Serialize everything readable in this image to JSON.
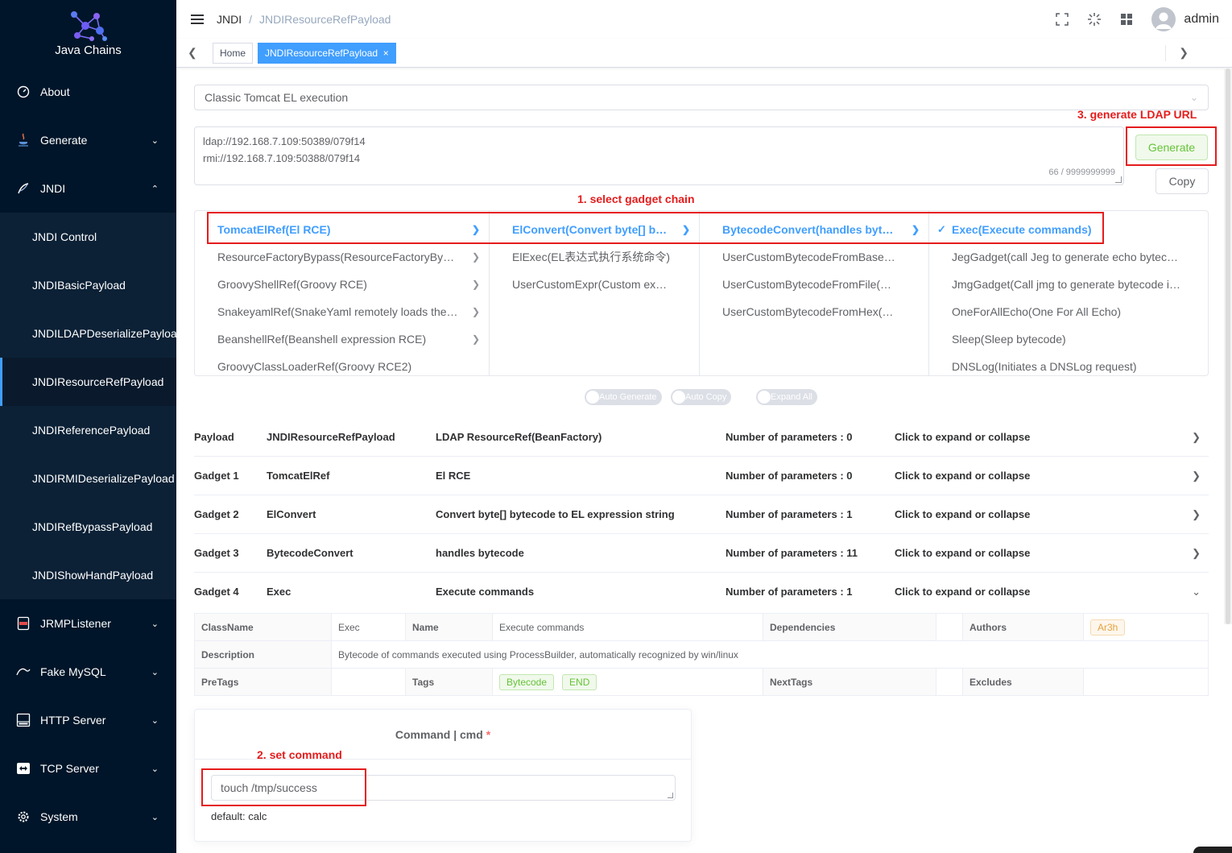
{
  "app": {
    "name": "Java Chains"
  },
  "sidebar": {
    "items": [
      {
        "label": "About",
        "icon": "dashboard-icon"
      },
      {
        "label": "Generate",
        "icon": "java-icon"
      },
      {
        "label": "JNDI",
        "icon": "feather-icon"
      },
      {
        "label": "JNDI Control"
      },
      {
        "label": "JNDIBasicPayload"
      },
      {
        "label": "JNDILDAPDeserializePayload"
      },
      {
        "label": "JNDIResourceRefPayload"
      },
      {
        "label": "JNDIReferencePayload"
      },
      {
        "label": "JNDIRMIDeserializePayload"
      },
      {
        "label": "JNDIRefBypassPayload"
      },
      {
        "label": "JNDIShowHandPayload"
      },
      {
        "label": "JRMPListener",
        "icon": "jrmp-icon"
      },
      {
        "label": "Fake MySQL",
        "icon": "mysql-icon"
      },
      {
        "label": "HTTP Server",
        "icon": "http-icon"
      },
      {
        "label": "TCP Server",
        "icon": "tcp-icon"
      },
      {
        "label": "System",
        "icon": "gear-icon"
      }
    ]
  },
  "header": {
    "breadcrumb": [
      "JNDI",
      "JNDIResourceRefPayload"
    ],
    "user": "admin"
  },
  "tags": {
    "home": "Home",
    "active": "JNDIResourceRefPayload",
    "close": "×"
  },
  "form": {
    "select_value": "Classic Tomcat EL execution",
    "urls": [
      "ldap://192.168.7.109:50389/079f14",
      "rmi://192.168.7.109:50388/079f14"
    ],
    "char_count": "66 / 9999999999",
    "generate_label": "Generate",
    "copy_label": "Copy"
  },
  "annotations": {
    "generate": "3. generate LDAP URL",
    "select": "1. select  gadget chain",
    "command": "2. set command"
  },
  "cascader": {
    "col1": [
      "TomcatElRef(El RCE)",
      "ResourceFactoryBypass(ResourceFactoryBy…",
      "GroovyShellRef(Groovy RCE)",
      "SnakeyamlRef(SnakeYaml remotely loads the…",
      "BeanshellRef(Beanshell expression RCE)",
      "GroovyClassLoaderRef(Groovy RCE2)"
    ],
    "col2": [
      "ElConvert(Convert byte[] b…",
      "ElExec(EL表达式执行系统命令)",
      "UserCustomExpr(Custom ex…"
    ],
    "col3": [
      "BytecodeConvert(handles byt…",
      "UserCustomBytecodeFromBase…",
      "UserCustomBytecodeFromFile(…",
      "UserCustomBytecodeFromHex(…"
    ],
    "col4": [
      "Exec(Execute commands)",
      "JegGadget(call Jeg to generate echo bytec…",
      "JmgGadget(Call jmg to generate bytecode i…",
      "OneForAllEcho(One For All Echo)",
      "Sleep(Sleep bytecode)",
      "DNSLog(Initiates a DNSLog request)"
    ]
  },
  "switches": [
    "Auto Generate",
    "Auto Copy",
    "Expand All"
  ],
  "rows": [
    {
      "c1": "Payload",
      "c2": "JNDIResourceRefPayload",
      "c3": "LDAP ResourceRef(BeanFactory)",
      "c4": "Number of parameters : 0",
      "c5": "Click to expand or collapse"
    },
    {
      "c1": "Gadget 1",
      "c2": "TomcatElRef",
      "c3": "El RCE",
      "c4": "Number of parameters : 0",
      "c5": "Click to expand or collapse"
    },
    {
      "c1": "Gadget 2",
      "c2": "ElConvert",
      "c3": "Convert byte[] bytecode to EL expression string",
      "c4": "Number of parameters : 1",
      "c5": "Click to expand or collapse"
    },
    {
      "c1": "Gadget 3",
      "c2": "BytecodeConvert",
      "c3": "handles bytecode",
      "c4": "Number of parameters : 11",
      "c5": "Click to expand or collapse"
    },
    {
      "c1": "Gadget 4",
      "c2": "Exec",
      "c3": "Execute commands",
      "c4": "Number of parameters : 1",
      "c5": "Click to expand or collapse"
    }
  ],
  "details": {
    "classname_label": "ClassName",
    "classname": "Exec",
    "name_label": "Name",
    "name": "Execute commands",
    "deps_label": "Dependencies",
    "authors_label": "Authors",
    "author": "Ar3h",
    "desc_label": "Description",
    "desc": "Bytecode of commands executed using ProcessBuilder, automatically recognized by win/linux",
    "pretags_label": "PreTags",
    "tags_label": "Tags",
    "tag1": "Bytecode",
    "tag2": "END",
    "nexttags_label": "NextTags",
    "excludes_label": "Excludes"
  },
  "command": {
    "title": "Command | cmd",
    "required": "*",
    "value": "touch /tmp/success",
    "default": "default: calc"
  },
  "colors": {
    "sidebar": "#001529",
    "accent": "#409eff",
    "annotation": "#e51c1c",
    "success": "#67c23a"
  }
}
